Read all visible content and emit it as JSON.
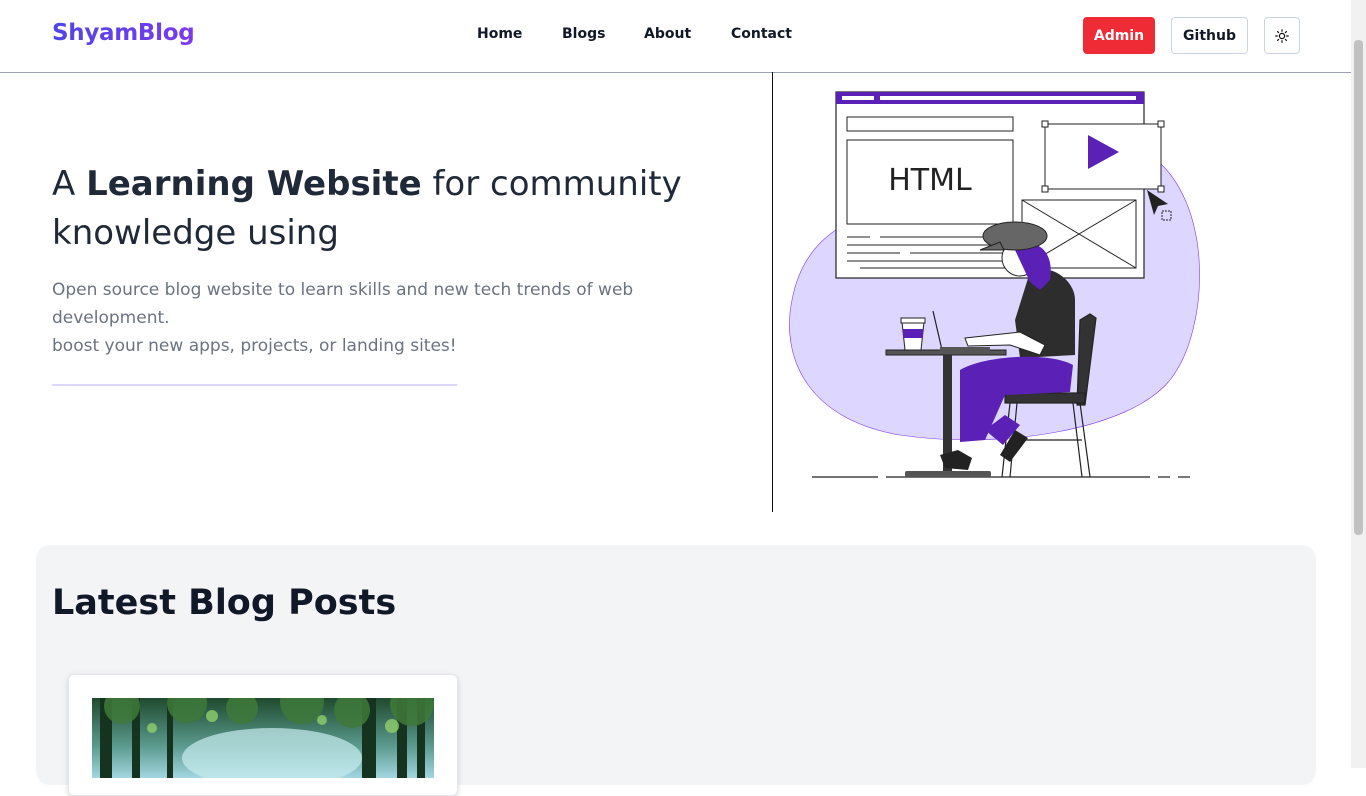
{
  "header": {
    "brand": "ShyamBlog",
    "nav": [
      "Home",
      "Blogs",
      "About",
      "Contact"
    ],
    "admin_label": "Admin",
    "github_label": "Github",
    "theme_toggle_icon": "sun-icon",
    "colors": {
      "admin": "#ef2b35",
      "brand_start": "#4f46e5",
      "brand_end": "#7c3aed"
    }
  },
  "hero": {
    "title_pre": "A ",
    "title_bold": "Learning Website",
    "title_post": " for community knowledge using",
    "desc_line1": "Open source blog website to learn skills and new tech trends of web development.",
    "desc_line2": "boost your new apps, projects, or landing sites!",
    "illustration_text": "HTML"
  },
  "latest": {
    "title": "Latest Blog Posts"
  }
}
